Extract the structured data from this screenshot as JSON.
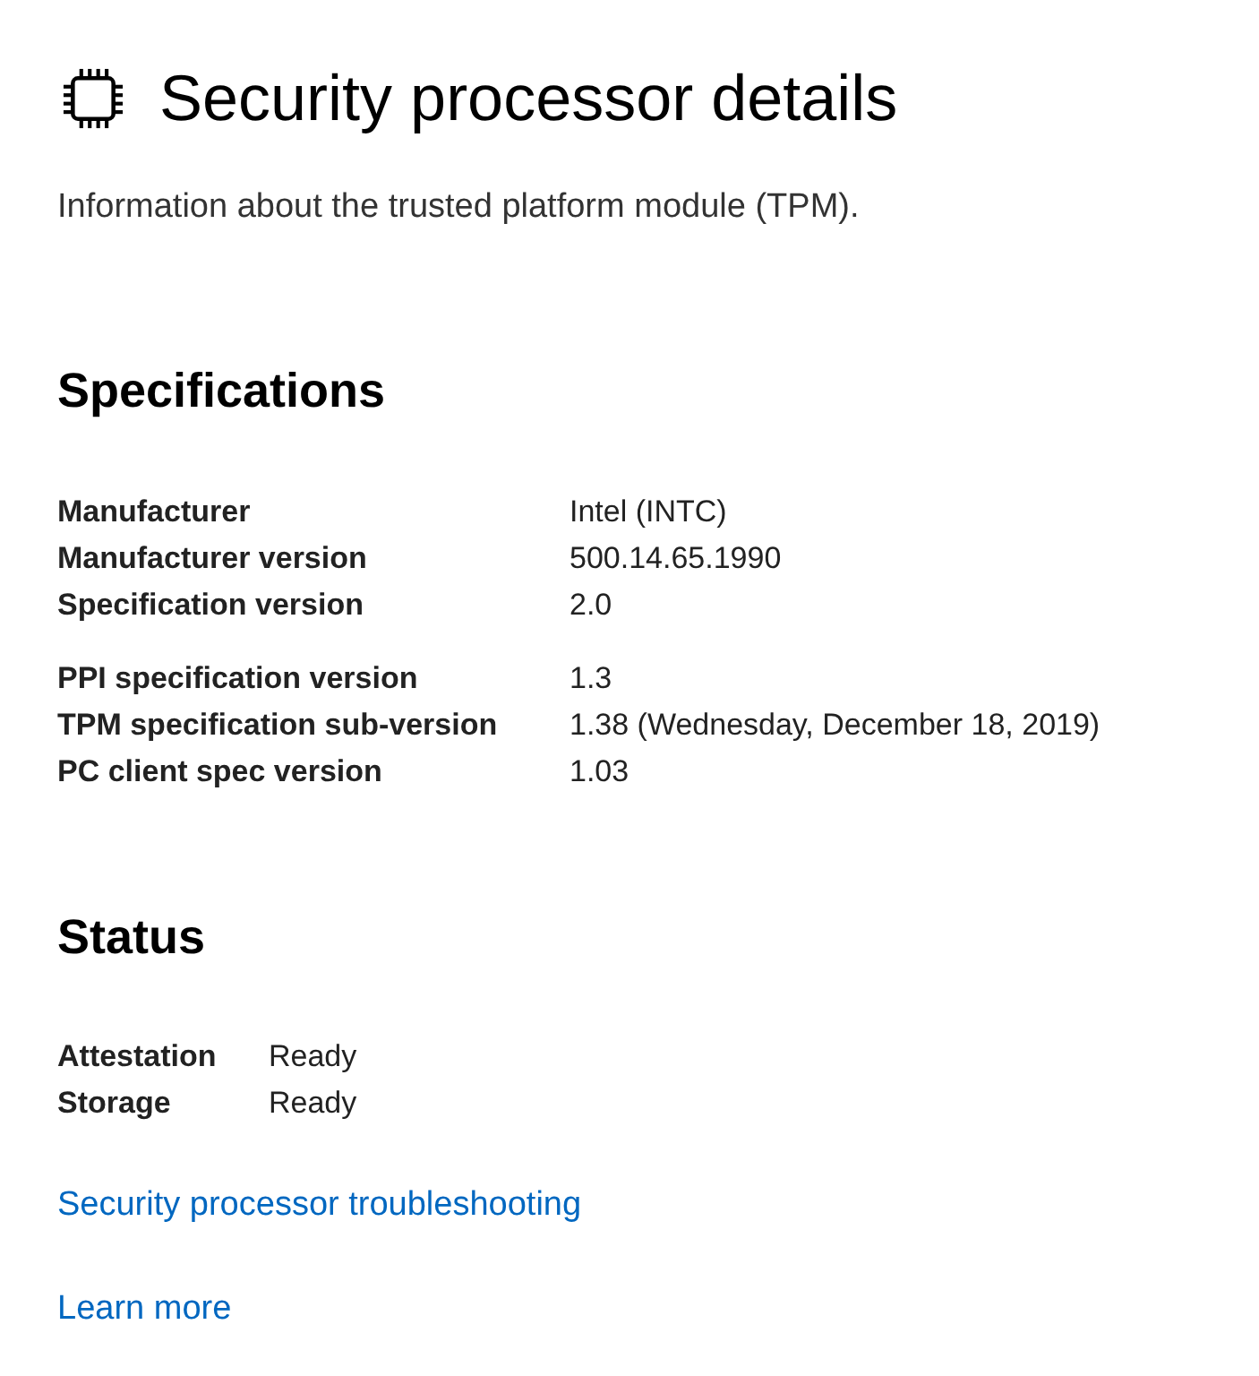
{
  "header": {
    "title": "Security processor details",
    "subtitle": "Information about the trusted platform module (TPM)."
  },
  "specifications": {
    "heading": "Specifications",
    "groups": [
      [
        {
          "label": "Manufacturer",
          "value": "Intel (INTC)"
        },
        {
          "label": "Manufacturer version",
          "value": "500.14.65.1990"
        },
        {
          "label": "Specification version",
          "value": "2.0"
        }
      ],
      [
        {
          "label": "PPI specification version",
          "value": "1.3"
        },
        {
          "label": "TPM specification sub-version",
          "value": "1.38 (Wednesday, December 18, 2019)"
        },
        {
          "label": "PC client spec version",
          "value": "1.03"
        }
      ]
    ]
  },
  "status": {
    "heading": "Status",
    "rows": [
      {
        "label": "Attestation",
        "value": "Ready"
      },
      {
        "label": "Storage",
        "value": "Ready"
      }
    ]
  },
  "links": [
    "Security processor troubleshooting",
    "Learn more"
  ]
}
